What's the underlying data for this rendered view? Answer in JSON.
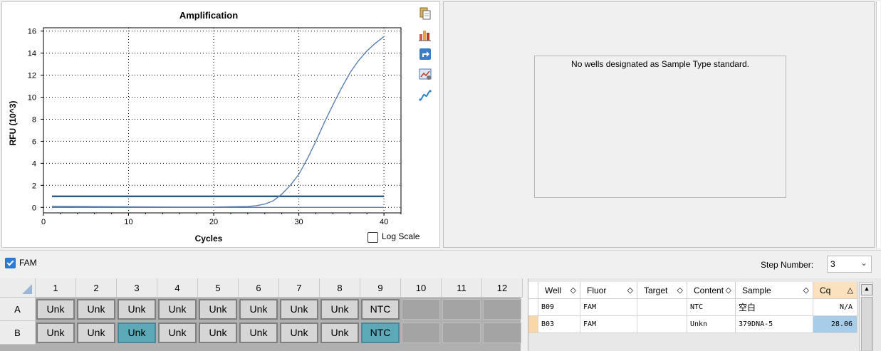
{
  "chart": {
    "title": "Amplification",
    "ylabel": "RFU (10^3)",
    "xlabel": "Cycles",
    "log_scale_label": "Log Scale",
    "log_scale_checked": false
  },
  "chart_data": {
    "type": "line",
    "title": "Amplification",
    "xlabel": "Cycles",
    "ylabel": "RFU (10^3)",
    "xlim": [
      0,
      42
    ],
    "ylim": [
      -0.5,
      16.3
    ],
    "xticks": [
      0,
      10,
      20,
      30,
      40
    ],
    "yticks": [
      0,
      2,
      4,
      6,
      8,
      10,
      12,
      14,
      16
    ],
    "grid": true,
    "threshold": 1.0,
    "series": [
      {
        "x": [
          1,
          5,
          10,
          15,
          20,
          24,
          25,
          26,
          27,
          28,
          29,
          30,
          31,
          32,
          33,
          34,
          35,
          36,
          37,
          38,
          39,
          40
        ],
        "y": [
          0.1,
          0.08,
          0.05,
          0.03,
          0.03,
          0.08,
          0.15,
          0.3,
          0.6,
          1.2,
          2.0,
          3.0,
          4.4,
          6.0,
          7.7,
          9.3,
          10.8,
          12.2,
          13.3,
          14.2,
          14.9,
          15.5
        ],
        "color": "#5b7fb0"
      },
      {
        "x": [
          1,
          40
        ],
        "y": [
          0.0,
          0.0
        ],
        "color": "#5b7fb0"
      }
    ],
    "threshold_color": "#1f4e79"
  },
  "standard_panel": {
    "message": "No wells designated as Sample Type standard."
  },
  "fluor_bar": {
    "fam_label": "FAM",
    "fam_checked": true,
    "step_label": "Step Number:",
    "step_value": "3"
  },
  "plate": {
    "columns": [
      "1",
      "2",
      "3",
      "4",
      "5",
      "6",
      "7",
      "8",
      "9",
      "10",
      "11",
      "12"
    ],
    "rows": [
      {
        "label": "A",
        "wells": [
          "Unk",
          "Unk",
          "Unk",
          "Unk",
          "Unk",
          "Unk",
          "Unk",
          "Unk",
          "NTC",
          "",
          "",
          ""
        ]
      },
      {
        "label": "B",
        "wells": [
          "Unk",
          "Unk",
          "Unk",
          "Unk",
          "Unk",
          "Unk",
          "Unk",
          "Unk",
          "NTC",
          "",
          "",
          ""
        ]
      }
    ]
  },
  "table": {
    "headers": [
      "Well",
      "Fluor",
      "Target",
      "Content",
      "Sample",
      "Cq"
    ],
    "rows": [
      {
        "well": "B09",
        "fluor": "FAM",
        "target": "",
        "content": "NTC",
        "sample": "空白",
        "cq": "N/A"
      },
      {
        "well": "B03",
        "fluor": "FAM",
        "target": "",
        "content": "Unkn",
        "sample": "379DNA-5",
        "cq": "28.06"
      }
    ]
  },
  "toolbar_icons": [
    "copy-icon",
    "chart-bars-icon",
    "export-icon",
    "chart-settings-icon",
    "curve-icon"
  ]
}
